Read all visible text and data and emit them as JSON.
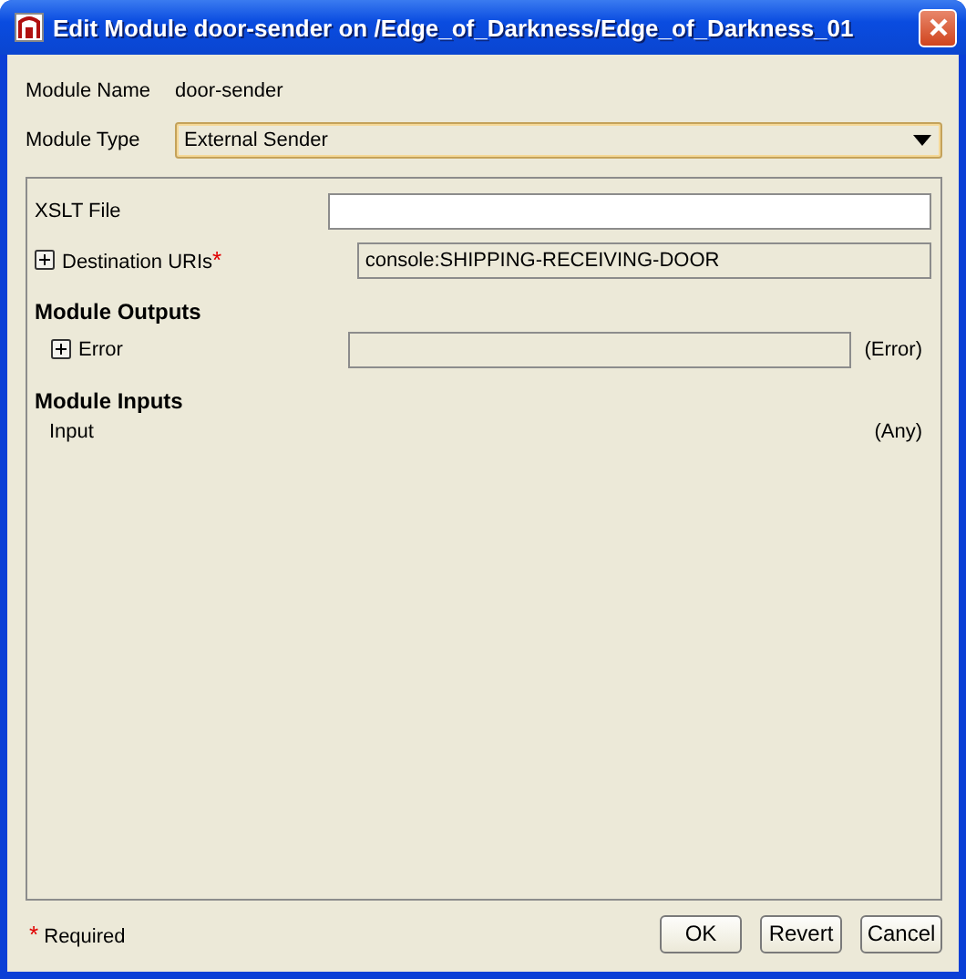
{
  "window": {
    "title": "Edit Module door-sender on /Edge_of_Darkness/Edge_of_Darkness_01"
  },
  "module_name": {
    "label": "Module Name",
    "value": "door-sender"
  },
  "module_type": {
    "label": "Module Type",
    "value": "External Sender"
  },
  "required_mark": "*",
  "xslt_file": {
    "label": "XSLT File"
  },
  "destination_uris": {
    "label": "Destination URIs",
    "required": true,
    "expanded": false,
    "value": "console:SHIPPING-RECEIVING-DOOR"
  },
  "module_outputs": {
    "heading": "Module Outputs",
    "items": [
      {
        "name": "Error",
        "expanded": false,
        "type": "(Error)"
      }
    ]
  },
  "module_inputs": {
    "heading": "Module Inputs",
    "items": [
      {
        "name": "Input",
        "type": "(Any)"
      }
    ]
  },
  "footer": {
    "note": "Required"
  },
  "buttons": [
    {
      "label": "OK"
    },
    {
      "label": "Revert"
    },
    {
      "label": "Cancel"
    }
  ]
}
